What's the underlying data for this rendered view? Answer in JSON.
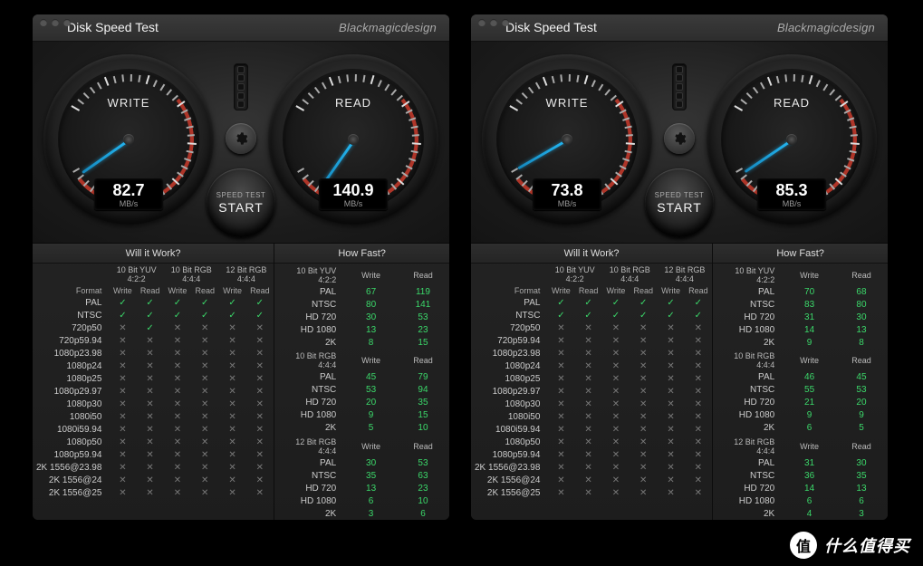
{
  "app": {
    "title": "Disk Speed Test",
    "brand": "Blackmagicdesign",
    "start_sub": "SPEED TEST",
    "start_label": "START",
    "will_label": "Will it Work?",
    "fast_label": "How Fast?",
    "format_label": "Format",
    "write_label_short": "Write",
    "read_label_short": "Read",
    "unit": "MB/s"
  },
  "groups": {
    "g1": "10 Bit YUV 4:2:2",
    "g2": "10 Bit RGB 4:4:4",
    "g3": "12 Bit RGB 4:4:4"
  },
  "formats": [
    "PAL",
    "NTSC",
    "720p50",
    "720p59.94",
    "1080p23.98",
    "1080p24",
    "1080p25",
    "1080p29.97",
    "1080p30",
    "1080i50",
    "1080i59.94",
    "1080p50",
    "1080p59.94",
    "2K 1556@23.98",
    "2K 1556@24",
    "2K 1556@25"
  ],
  "fast_formats": [
    "PAL",
    "NTSC",
    "HD 720",
    "HD 1080",
    "2K"
  ],
  "panels": [
    {
      "write": {
        "label": "WRITE",
        "value": "82.7",
        "angle": 55
      },
      "read": {
        "label": "READ",
        "value": "140.9",
        "angle": 35
      },
      "will": [
        [
          true,
          true,
          true,
          true,
          true,
          true
        ],
        [
          true,
          true,
          true,
          true,
          true,
          true
        ],
        [
          false,
          true,
          false,
          false,
          false,
          false
        ],
        [
          false,
          false,
          false,
          false,
          false,
          false
        ],
        [
          false,
          false,
          false,
          false,
          false,
          false
        ],
        [
          false,
          false,
          false,
          false,
          false,
          false
        ],
        [
          false,
          false,
          false,
          false,
          false,
          false
        ],
        [
          false,
          false,
          false,
          false,
          false,
          false
        ],
        [
          false,
          false,
          false,
          false,
          false,
          false
        ],
        [
          false,
          false,
          false,
          false,
          false,
          false
        ],
        [
          false,
          false,
          false,
          false,
          false,
          false
        ],
        [
          false,
          false,
          false,
          false,
          false,
          false
        ],
        [
          false,
          false,
          false,
          false,
          false,
          false
        ],
        [
          false,
          false,
          false,
          false,
          false,
          false
        ],
        [
          false,
          false,
          false,
          false,
          false,
          false
        ],
        [
          false,
          false,
          false,
          false,
          false,
          false
        ]
      ],
      "fast": {
        "g1": [
          [
            67,
            119
          ],
          [
            80,
            141
          ],
          [
            30,
            53
          ],
          [
            13,
            23
          ],
          [
            8,
            15
          ]
        ],
        "g2": [
          [
            45,
            79
          ],
          [
            53,
            94
          ],
          [
            20,
            35
          ],
          [
            9,
            15
          ],
          [
            5,
            10
          ]
        ],
        "g3": [
          [
            30,
            53
          ],
          [
            35,
            63
          ],
          [
            13,
            23
          ],
          [
            6,
            10
          ],
          [
            3,
            6
          ]
        ]
      }
    },
    {
      "write": {
        "label": "WRITE",
        "value": "73.8",
        "angle": 60
      },
      "read": {
        "label": "READ",
        "value": "85.3",
        "angle": 56
      },
      "will": [
        [
          true,
          true,
          true,
          true,
          true,
          true
        ],
        [
          true,
          true,
          true,
          true,
          true,
          true
        ],
        [
          false,
          false,
          false,
          false,
          false,
          false
        ],
        [
          false,
          false,
          false,
          false,
          false,
          false
        ],
        [
          false,
          false,
          false,
          false,
          false,
          false
        ],
        [
          false,
          false,
          false,
          false,
          false,
          false
        ],
        [
          false,
          false,
          false,
          false,
          false,
          false
        ],
        [
          false,
          false,
          false,
          false,
          false,
          false
        ],
        [
          false,
          false,
          false,
          false,
          false,
          false
        ],
        [
          false,
          false,
          false,
          false,
          false,
          false
        ],
        [
          false,
          false,
          false,
          false,
          false,
          false
        ],
        [
          false,
          false,
          false,
          false,
          false,
          false
        ],
        [
          false,
          false,
          false,
          false,
          false,
          false
        ],
        [
          false,
          false,
          false,
          false,
          false,
          false
        ],
        [
          false,
          false,
          false,
          false,
          false,
          false
        ],
        [
          false,
          false,
          false,
          false,
          false,
          false
        ]
      ],
      "fast": {
        "g1": [
          [
            70,
            68
          ],
          [
            83,
            80
          ],
          [
            31,
            30
          ],
          [
            14,
            13
          ],
          [
            9,
            8
          ]
        ],
        "g2": [
          [
            46,
            45
          ],
          [
            55,
            53
          ],
          [
            21,
            20
          ],
          [
            9,
            9
          ],
          [
            6,
            5
          ]
        ],
        "g3": [
          [
            31,
            30
          ],
          [
            36,
            35
          ],
          [
            14,
            13
          ],
          [
            6,
            6
          ],
          [
            4,
            3
          ]
        ]
      }
    }
  ],
  "watermark": {
    "badge": "值",
    "text": "什么值得买"
  },
  "chart_data": [
    {
      "type": "gauge",
      "title": "WRITE",
      "value": 82.7,
      "unit": "MB/s",
      "range": [
        0,
        6000
      ]
    },
    {
      "type": "gauge",
      "title": "READ",
      "value": 140.9,
      "unit": "MB/s",
      "range": [
        0,
        6000
      ]
    },
    {
      "type": "gauge",
      "title": "WRITE",
      "value": 73.8,
      "unit": "MB/s",
      "range": [
        0,
        6000
      ]
    },
    {
      "type": "gauge",
      "title": "READ",
      "value": 85.3,
      "unit": "MB/s",
      "range": [
        0,
        6000
      ]
    }
  ]
}
